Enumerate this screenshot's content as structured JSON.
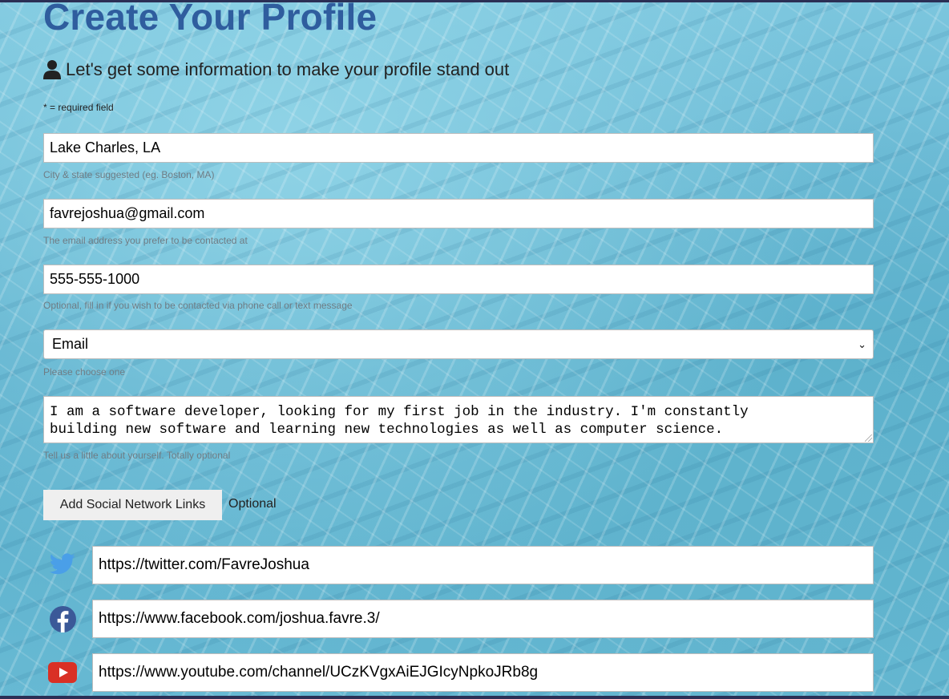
{
  "page": {
    "title": "Create Your Profile",
    "subtitle": "Let's get some information to make your profile stand out",
    "required_note": "* = required field"
  },
  "form": {
    "location": {
      "value": "Lake Charles, LA",
      "hint": "City & state suggested (eg. Boston, MA)"
    },
    "email": {
      "value": "favrejoshua@gmail.com",
      "hint": "The email address you prefer to be contacted at"
    },
    "phone": {
      "value": "555-555-1000",
      "hint": "Optional, fill in if you wish to be contacted via phone call or text message"
    },
    "contact_method": {
      "selected": "Email",
      "hint": "Please choose one"
    },
    "bio": {
      "value": "I am a software developer, looking for my first job in the industry. I'm constantly\nbuilding new software and learning new technologies as well as computer science.",
      "hint": "Tell us a little about yourself. Totally optional"
    }
  },
  "social": {
    "button_label": "Add Social Network Links",
    "optional_label": "Optional",
    "links": [
      {
        "icon": "twitter-icon",
        "value": "https://twitter.com/FavreJoshua"
      },
      {
        "icon": "facebook-icon",
        "value": "https://www.facebook.com/joshua.favre.3/"
      },
      {
        "icon": "youtube-icon",
        "value": "https://www.youtube.com/channel/UCzKVgxAiEJGIcyNpkoJRb8g"
      }
    ]
  },
  "colors": {
    "title": "#2f5d9e",
    "twitter": "#4a9fe8",
    "facebook": "#3b5998",
    "youtube": "#d93025"
  }
}
